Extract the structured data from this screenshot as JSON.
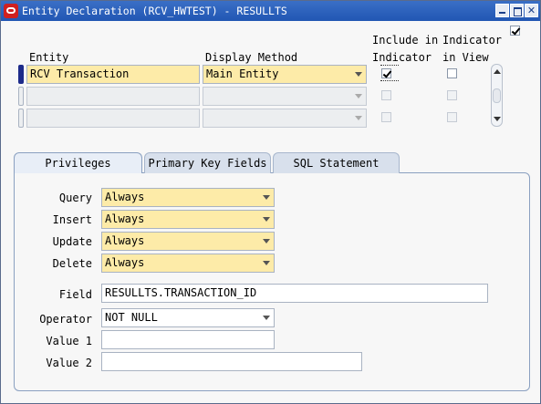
{
  "window": {
    "title": "Entity Declaration (RCV_HWTEST) - RESULLTS",
    "header_checkbox_checked": true
  },
  "grid": {
    "headers": {
      "entity": "Entity",
      "display_method": "Display Method",
      "include_line1": "Include in",
      "include_line2": "Indicator",
      "indicator_line1": "Indicator",
      "indicator_line2": "in View"
    },
    "rows": [
      {
        "entity": "RCV Transaction",
        "display_method": "Main Entity",
        "include_in_indicator": true,
        "indicator_in_view": false,
        "current": true
      },
      {
        "entity": "",
        "display_method": "",
        "include_in_indicator": false,
        "indicator_in_view": false,
        "current": false
      },
      {
        "entity": "",
        "display_method": "",
        "include_in_indicator": false,
        "indicator_in_view": false,
        "current": false
      }
    ]
  },
  "tabs": [
    {
      "label": "Privileges",
      "active": true
    },
    {
      "label": "Primary Key Fields",
      "active": false
    },
    {
      "label": "SQL Statement",
      "active": false
    }
  ],
  "privileges": {
    "query_label": "Query",
    "query_value": "Always",
    "insert_label": "Insert",
    "insert_value": "Always",
    "update_label": "Update",
    "update_value": "Always",
    "delete_label": "Delete",
    "delete_value": "Always",
    "field_label": "Field",
    "field_value": "RESULLTS.TRANSACTION_ID",
    "operator_label": "Operator",
    "operator_value": "NOT NULL",
    "value1_label": "Value 1",
    "value1_value": "",
    "value2_label": "Value 2",
    "value2_value": ""
  }
}
